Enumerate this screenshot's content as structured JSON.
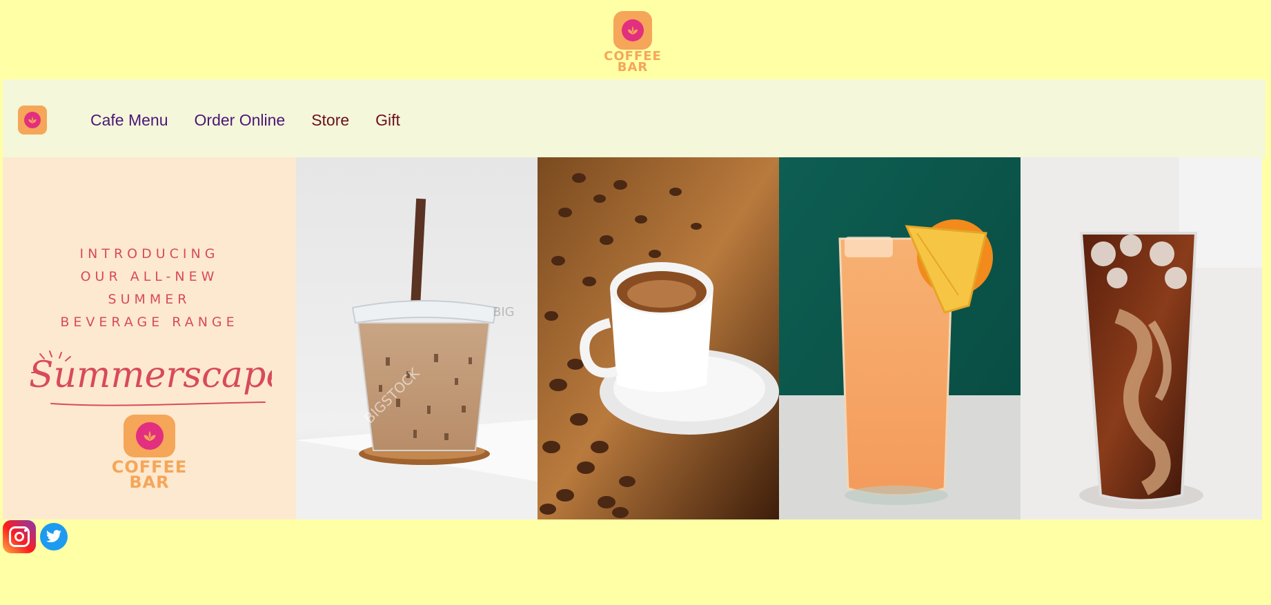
{
  "brand": {
    "wordmark_line1": "COFFEE",
    "wordmark_line2": "BAR",
    "colors": {
      "orange": "#f5a659",
      "magenta": "#e32f7f",
      "background": "#ffffa6",
      "nav_bg": "#f4f7d9"
    }
  },
  "nav": {
    "items": [
      {
        "label": "Cafe Menu",
        "color": "#4b1678"
      },
      {
        "label": "Order Online",
        "color": "#4b1678"
      },
      {
        "label": "Store",
        "color": "#6b0f1f"
      },
      {
        "label": "Gift",
        "color": "#6b0f1f"
      }
    ]
  },
  "hero": {
    "promo": {
      "lines": [
        "INTRODUCING",
        "OUR ALL-NEW",
        "SUMMER",
        "BEVERAGE RANGE"
      ],
      "script_title": "Summerscape"
    },
    "photos": [
      {
        "name": "iced-latte-photo",
        "watermark": "BIGSTOCK"
      },
      {
        "name": "espresso-beans-photo"
      },
      {
        "name": "orange-juice-photo"
      },
      {
        "name": "cold-brew-photo"
      }
    ]
  },
  "social": {
    "icons": [
      "instagram-icon",
      "twitter-icon"
    ]
  }
}
